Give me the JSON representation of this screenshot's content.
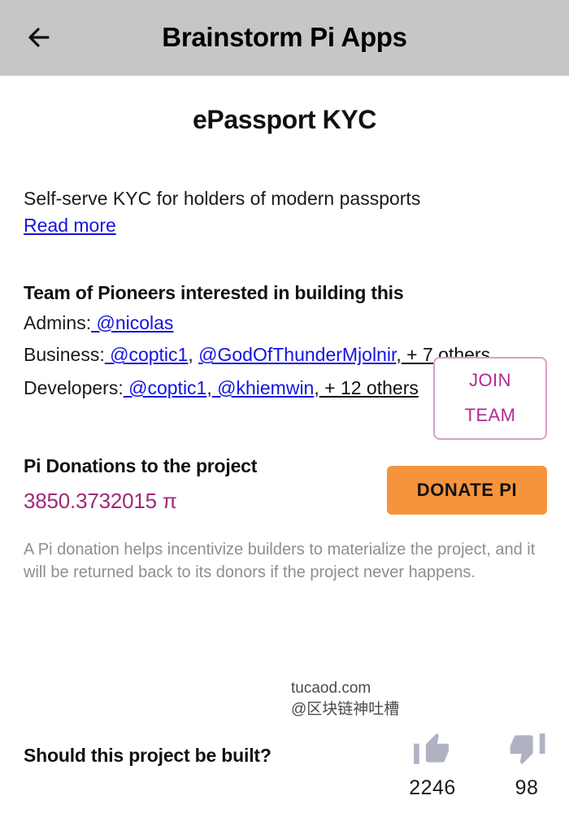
{
  "header": {
    "back_icon": "arrow-left-icon",
    "title": "Brainstorm Pi Apps"
  },
  "project": {
    "title": "ePassport KYC",
    "description": "Self-serve KYC for holders of modern passports",
    "read_more_label": "Read more"
  },
  "team": {
    "heading": "Team of Pioneers interested in building this",
    "admins_label": "Admins:",
    "admins": [
      {
        "handle": " @nicolas"
      }
    ],
    "business_label": "Business:",
    "business": [
      {
        "handle": " @coptic1"
      },
      {
        "handle": " @GodOfThunderMjolnir"
      }
    ],
    "business_more": " + 7 others",
    "developers_label": "Developers:",
    "developers": [
      {
        "handle": " @coptic1"
      },
      {
        "handle": " @khiemwin"
      }
    ],
    "developers_more": " + 12 others",
    "comma": ",",
    "join_button_line1": "JOIN",
    "join_button_line2": "TEAM"
  },
  "donations": {
    "heading": "Pi Donations to the project",
    "amount": "3850.3732015 π",
    "donate_button_label": "DONATE PI",
    "disclaimer": "A Pi donation helps incentivize builders to materialize the project, and it will be returned back to its donors if the project never happens."
  },
  "watermark": {
    "line1": "tucaod.com",
    "line2": "@区块链神吐槽"
  },
  "vote": {
    "question": "Should this project be built?",
    "upvote_icon": "thumbs-up-icon",
    "upvote_count": "2246",
    "downvote_icon": "thumbs-down-icon",
    "downvote_count": "98"
  },
  "colors": {
    "header_bg": "#c6c6c6",
    "link_blue": "#1414e0",
    "accent_magenta": "#a32878",
    "join_border": "#d9a0c8",
    "donate_orange": "#f5943c",
    "thumb_gray": "#b0b2c4",
    "muted_text": "#8e8e8e"
  }
}
